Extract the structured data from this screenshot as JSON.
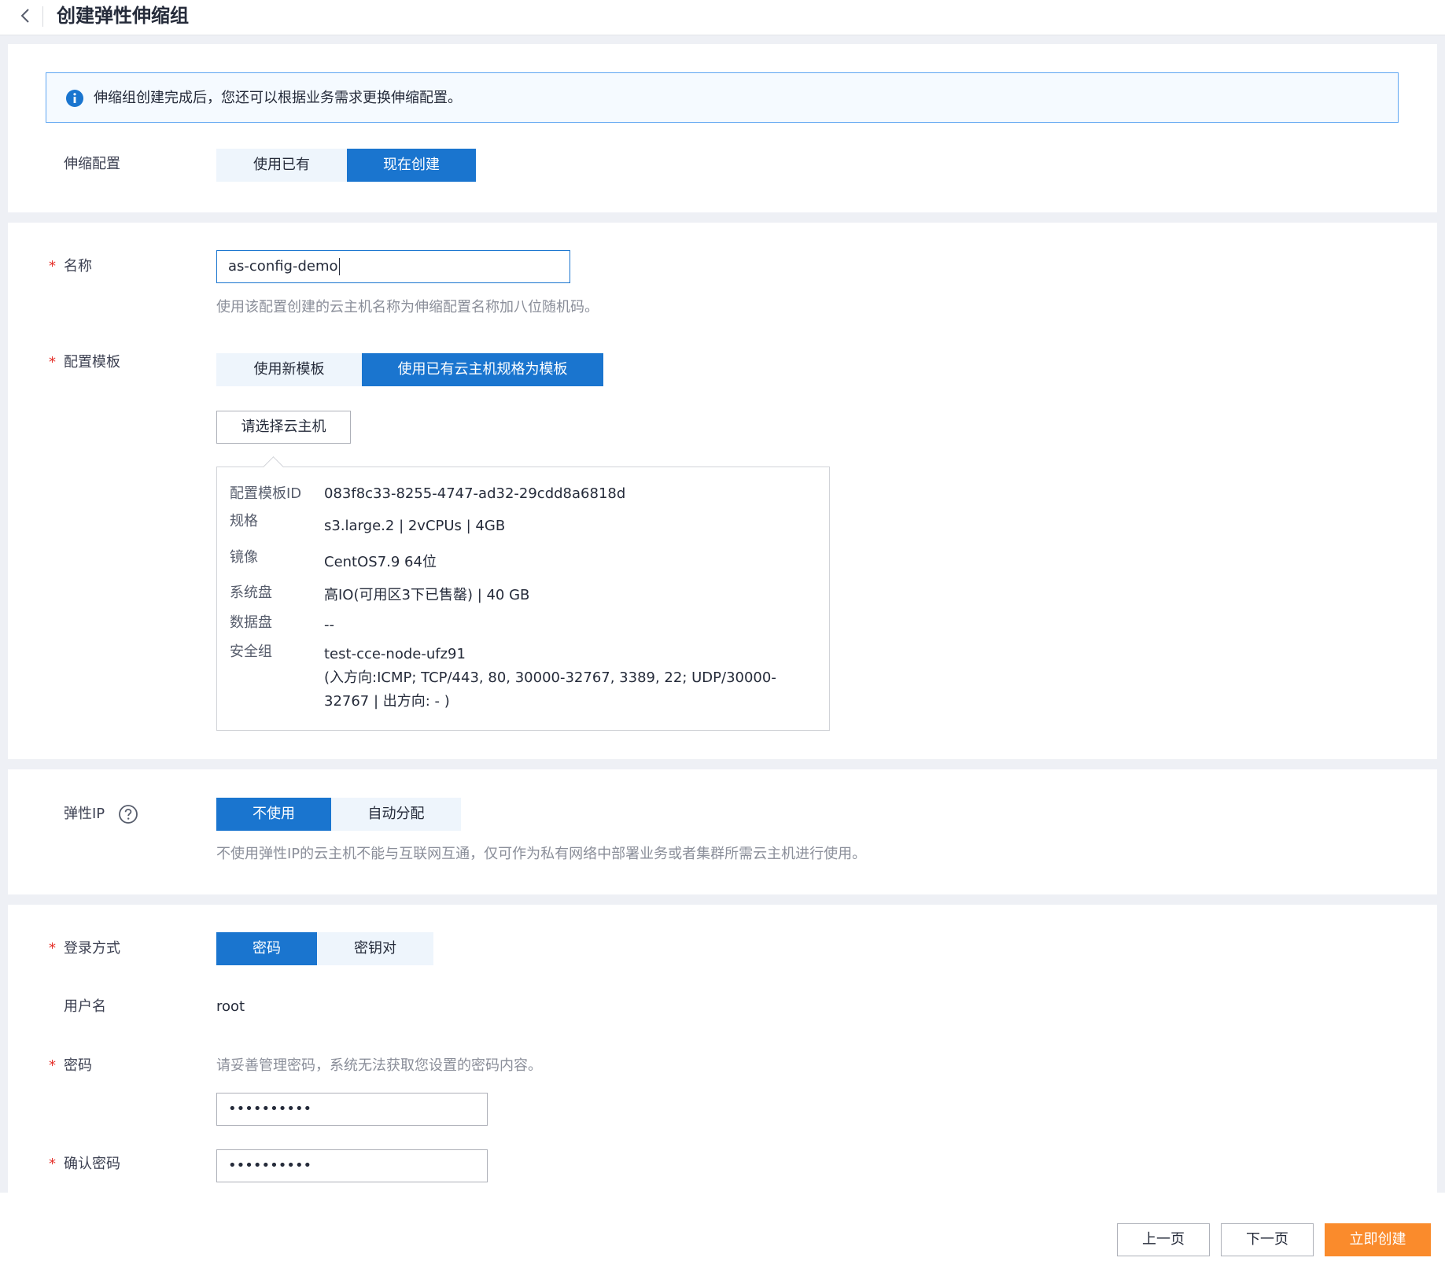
{
  "header": {
    "title": "创建弹性伸缩组",
    "back_icon": "chevron-left-icon"
  },
  "notice": {
    "icon": "info-icon",
    "text": "伸缩组创建完成后，您还可以根据业务需求更换伸缩配置。"
  },
  "scaling_config": {
    "label": "伸缩配置",
    "options": [
      "使用已有",
      "现在创建"
    ],
    "selected": "现在创建"
  },
  "name": {
    "label": "名称",
    "required_mark": "*",
    "value": "as-config-demo",
    "hint": "使用该配置创建的云主机名称为伸缩配置名称加八位随机码。"
  },
  "template": {
    "label": "配置模板",
    "required_mark": "*",
    "options": [
      "使用新模板",
      "使用已有云主机规格为模板"
    ],
    "selected": "使用已有云主机规格为模板",
    "select_vm_label": "请选择云主机",
    "details": {
      "template_id_key": "配置模板ID",
      "template_id_val": "083f8c33-8255-4747-ad32-29cdd8a6818d",
      "spec_key": "规格",
      "spec_val": "s3.large.2 | 2vCPUs | 4GB",
      "image_key": "镜像",
      "image_val": "CentOS7.9 64位",
      "sys_disk_key": "系统盘",
      "sys_disk_val": "高IO(可用区3下已售罄) | 40 GB",
      "data_disk_key": "数据盘",
      "data_disk_val": "--",
      "sg_key": "安全组",
      "sg_val_line1": "test-cce-node-ufz91",
      "sg_val_line2": "(入方向:ICMP; TCP/443, 80, 30000-32767, 3389, 22; UDP/30000-32767 | 出方向: - )"
    }
  },
  "eip": {
    "label": "弹性IP",
    "help_icon": "question-circle-icon",
    "options": [
      "不使用",
      "自动分配"
    ],
    "selected": "不使用",
    "hint": "不使用弹性IP的云主机不能与互联网互通，仅可作为私有网络中部署业务或者集群所需云主机进行使用。"
  },
  "login": {
    "label": "登录方式",
    "required_mark": "*",
    "options": [
      "密码",
      "密钥对"
    ],
    "selected": "密码"
  },
  "username": {
    "label": "用户名",
    "value": "root"
  },
  "password": {
    "label": "密码",
    "required_mark": "*",
    "hint": "请妥善管理密码，系统无法获取您设置的密码内容。",
    "value": "••••••••••"
  },
  "confirm_password": {
    "label": "确认密码",
    "required_mark": "*",
    "value": "••••••••••"
  },
  "footer": {
    "prev_label": "上一页",
    "next_label": "下一页",
    "create_label": "立即创建"
  },
  "colors": {
    "primary": "#1a75cf",
    "accent_orange": "#fa8b2c",
    "required_red": "#e5302a"
  }
}
